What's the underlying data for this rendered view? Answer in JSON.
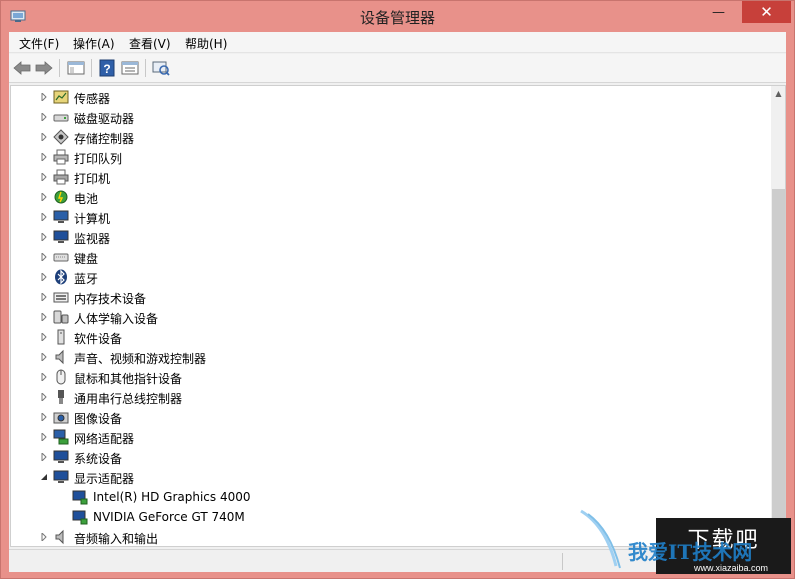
{
  "window": {
    "title": "设备管理器",
    "minimize_glyph": "—",
    "maximize_glyph": "☐",
    "close_glyph": "✕"
  },
  "menubar": {
    "items": [
      "文件(F)",
      "操作(A)",
      "查看(V)",
      "帮助(H)"
    ]
  },
  "toolbar": {
    "buttons": [
      "back-icon",
      "forward-icon",
      "show-hide-console-tree-icon",
      "help-icon",
      "properties-icon",
      "scan-hardware-icon"
    ]
  },
  "tree": {
    "items": [
      {
        "label": "传感器",
        "icon": "sensor-icon",
        "expanded": false,
        "level": 0
      },
      {
        "label": "磁盘驱动器",
        "icon": "disk-drive-icon",
        "expanded": false,
        "level": 0
      },
      {
        "label": "存储控制器",
        "icon": "storage-controller-icon",
        "expanded": false,
        "level": 0
      },
      {
        "label": "打印队列",
        "icon": "print-queue-icon",
        "expanded": false,
        "level": 0
      },
      {
        "label": "打印机",
        "icon": "printer-icon",
        "expanded": false,
        "level": 0
      },
      {
        "label": "电池",
        "icon": "battery-icon",
        "expanded": false,
        "level": 0
      },
      {
        "label": "计算机",
        "icon": "computer-icon",
        "expanded": false,
        "level": 0
      },
      {
        "label": "监视器",
        "icon": "monitor-icon",
        "expanded": false,
        "level": 0
      },
      {
        "label": "键盘",
        "icon": "keyboard-icon",
        "expanded": false,
        "level": 0
      },
      {
        "label": "蓝牙",
        "icon": "bluetooth-icon",
        "expanded": false,
        "level": 0
      },
      {
        "label": "内存技术设备",
        "icon": "memory-device-icon",
        "expanded": false,
        "level": 0
      },
      {
        "label": "人体学输入设备",
        "icon": "hid-icon",
        "expanded": false,
        "level": 0
      },
      {
        "label": "软件设备",
        "icon": "software-device-icon",
        "expanded": false,
        "level": 0
      },
      {
        "label": "声音、视频和游戏控制器",
        "icon": "speaker-icon",
        "expanded": false,
        "level": 0
      },
      {
        "label": "鼠标和其他指针设备",
        "icon": "mouse-icon",
        "expanded": false,
        "level": 0
      },
      {
        "label": "通用串行总线控制器",
        "icon": "usb-icon",
        "expanded": false,
        "level": 0
      },
      {
        "label": "图像设备",
        "icon": "camera-icon",
        "expanded": false,
        "level": 0
      },
      {
        "label": "网络适配器",
        "icon": "network-adapter-icon",
        "expanded": false,
        "level": 0
      },
      {
        "label": "系统设备",
        "icon": "system-device-icon",
        "expanded": false,
        "level": 0
      },
      {
        "label": "显示适配器",
        "icon": "display-adapter-icon",
        "expanded": true,
        "level": 0
      },
      {
        "label": "Intel(R) HD Graphics 4000",
        "icon": "display-adapter-icon",
        "expanded": null,
        "level": 1
      },
      {
        "label": "NVIDIA GeForce GT 740M",
        "icon": "display-adapter-icon",
        "expanded": null,
        "level": 1
      },
      {
        "label": "音频输入和输出",
        "icon": "speaker-icon",
        "expanded": false,
        "level": 0
      }
    ]
  },
  "watermark": {
    "text": "我爱IT技术网",
    "box_text": "下载吧",
    "url": "www.xiazaiba.com"
  },
  "colors": {
    "titlebar": "#e8918a",
    "close_button": "#c7403a",
    "tree_background": "#ffffff"
  }
}
